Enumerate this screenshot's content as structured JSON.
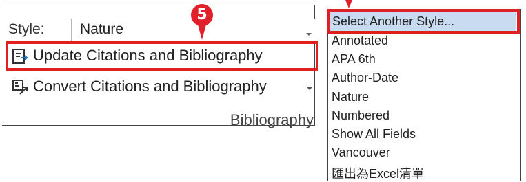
{
  "ribbon": {
    "style_label": "Style:",
    "style_value": "Nature",
    "update_label": "Update Citations and Bibliography",
    "convert_label": "Convert Citations and Bibliography",
    "group_name": "Bibliography",
    "callout_number": "5"
  },
  "style_list": {
    "items": [
      "Select Another Style...",
      "Annotated",
      "APA 6th",
      "Author-Date",
      "Nature",
      "Numbered",
      "Show All Fields",
      "Vancouver",
      "匯出為Excel清單"
    ]
  },
  "colors": {
    "highlight_red": "#e02020",
    "selection_blue": "#c9dbf1"
  }
}
